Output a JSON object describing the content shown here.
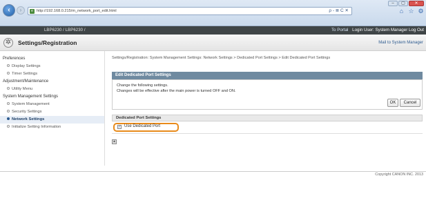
{
  "browser": {
    "url": "http://192.168.0.215/m_network_port_edit.html",
    "search_tools": "ρ - ≣ C ✕"
  },
  "app_bar": {
    "device": "LBP6230 / LBP6230 /",
    "to_portal": "To Portal",
    "login_user": "Login User: System Manager Log Out"
  },
  "title_bar": {
    "title": "Settings/Registration",
    "mail_link": "Mail to System Manager"
  },
  "sidebar": {
    "sections": [
      {
        "label": "Preferences",
        "items": [
          "Display Settings",
          "Timer Settings"
        ]
      },
      {
        "label": "Adjustment/Maintenance",
        "items": [
          "Utility Menu"
        ]
      },
      {
        "label": "System Management Settings",
        "items": [
          "System Management",
          "Security Settings",
          "Network Settings",
          "Initialize Setting Information"
        ]
      }
    ],
    "active_item": "Network Settings"
  },
  "main": {
    "breadcrumb": "Settings/Registration: System Management Settings: Network Settings > Dedicated Port Settings > Edit Dedicated Port Settings",
    "panel_title": "Edit Dedicated Port Settings",
    "message_line1": "Change the following settings.",
    "message_line2": "Changes will be effective after the main power is turned OFF and ON.",
    "ok_label": "OK",
    "cancel_label": "Cancel",
    "section_title": "Dedicated Port Settings",
    "checkbox_label": "Use Dedicated Port",
    "checkbox_checked": true
  },
  "footer": {
    "copyright": "Copyright CANON INC. 2013"
  },
  "colors": {
    "highlight": "#e88a1a",
    "panel_head": "#6f8aa0",
    "app_bar": "#3f4547"
  }
}
